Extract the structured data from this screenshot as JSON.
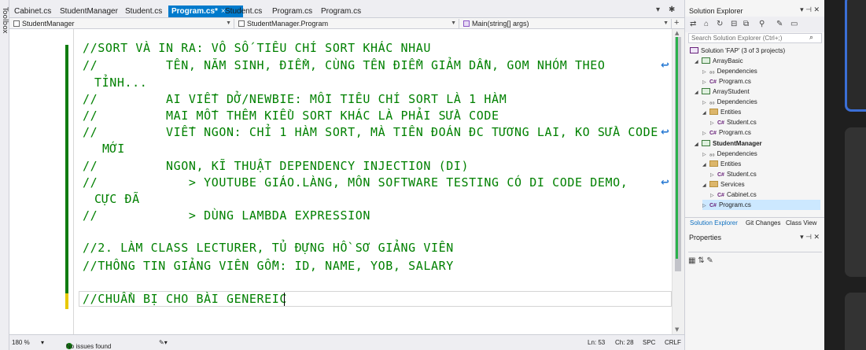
{
  "toolbox": {
    "label": "Toolbox"
  },
  "tabs": [
    {
      "label": "Cabinet.cs"
    },
    {
      "label": "StudentManager"
    },
    {
      "label": "Student.cs"
    },
    {
      "label": "Program.cs*"
    },
    {
      "label": "Student.cs"
    },
    {
      "label": "Program.cs"
    },
    {
      "label": "Program.cs"
    }
  ],
  "tab_close": "×",
  "navbar": {
    "project": "StudentManager",
    "class": "StudentManager.Program",
    "member": "Main(string[] args)"
  },
  "code_lines": [
    "//SORT VÀ IN RA: VÔ SỐ TIÊU CHÍ SORT KHÁC NHAU",
    "//         TÊN, NĂM SINH, ĐIỂM, CÙNG TÊN ĐIỂM GIẢM DẦN, GOM NHÓM THEO",
    "TỈNH...",
    "//         AI VIẾT DỞ/NEWBIE: MỖI TIÊU CHÍ SORT LÀ 1 HÀM",
    "//         MAI MỐT THÊM KIỂU SORT KHÁC LÀ PHẢI SỬA CODE",
    "//         VIẾT NGON: CHỈ 1 HÀM SORT, MÀ TIÊN ĐOÁN ĐC TƯƠNG LAI, KO SỬA CODE",
    "MỚI",
    "//         NGON, KĨ THUẬT DEPENDENCY INJECTION (DI)",
    "//            > YOUTUBE GIÁO.LÀNG, MÔN SOFTWARE TESTING CÓ DI CODE DEMO,",
    "CỰC ĐÃ",
    "//            > DÙNG LAMBDA EXPRESSION",
    "//2. LÀM CLASS LECTURER, TỦ ĐỰNG HỒ SƠ GIẢNG VIÊN",
    "//THÔNG TIN GIẢNG VIÊN GỒM: ID, NAME, YOB, SALARY",
    "//CHUẨN BỊ CHO BÀI GENEREIC"
  ],
  "status": {
    "zoom": "180 %",
    "issues": "No issues found",
    "line": "Ln: 53",
    "col": "Ch: 28",
    "mode": "SPC",
    "eol": "CRLF"
  },
  "solution_explorer": {
    "title": "Solution Explorer",
    "search_placeholder": "Search Solution Explorer (Ctrl+;)",
    "tree": [
      {
        "label": "Solution 'FAP' (3 of 3 projects)"
      },
      {
        "label": "ArrayBasic"
      },
      {
        "label": "Dependencies"
      },
      {
        "label": "Program.cs"
      },
      {
        "label": "ArrayStudent"
      },
      {
        "label": "Dependencies"
      },
      {
        "label": "Entities"
      },
      {
        "label": "Student.cs"
      },
      {
        "label": "Program.cs"
      },
      {
        "label": "StudentManager"
      },
      {
        "label": "Dependencies"
      },
      {
        "label": "Entities"
      },
      {
        "label": "Student.cs"
      },
      {
        "label": "Services"
      },
      {
        "label": "Cabinet.cs"
      },
      {
        "label": "Program.cs"
      }
    ],
    "tabs": [
      "Solution Explorer",
      "Git Changes",
      "Class View"
    ]
  },
  "properties": {
    "title": "Properties"
  },
  "colors": {
    "accent": "#007acc",
    "comment": "#008000",
    "change_bar": "#107c10",
    "unsaved_bar": "#e8c800",
    "selection": "#cce8ff"
  }
}
